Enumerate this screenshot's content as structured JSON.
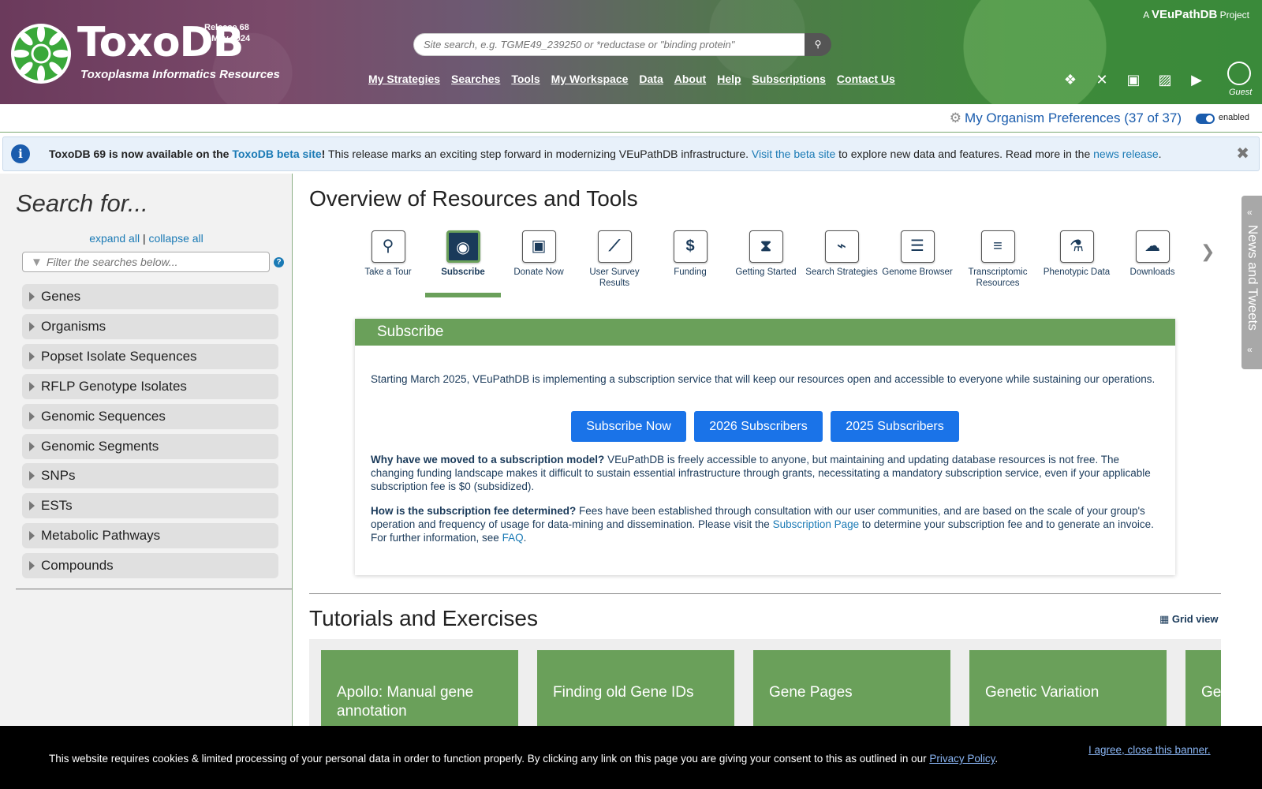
{
  "header": {
    "brand": "ToxoDB",
    "subtitle": "Toxoplasma Informatics Resources",
    "release": "Release 68",
    "release_date": "7 May 2024",
    "vpdb_prefix": "A",
    "vpdb_name": "VEuPathDB",
    "vpdb_suffix": "Project",
    "search_placeholder": "Site search, e.g. TGME49_239250 or *reductase or \"binding protein\"",
    "nav": [
      "My Strategies",
      "Searches",
      "Tools",
      "My Workspace",
      "Data",
      "About",
      "Help",
      "Subscriptions",
      "Contact Us"
    ],
    "guest_label": "Guest"
  },
  "org_pref": {
    "label": "My Organism Preferences (37 of 37)",
    "toggle_label": "enabled"
  },
  "announcement": {
    "bold_prefix": "ToxoDB 69 is now available on the ",
    "beta_link": "ToxoDB beta site",
    "bold_suffix": "!",
    "text1": " This release marks an exciting step forward in modernizing VEuPathDB infrastructure. ",
    "visit_link": "Visit the beta site",
    "text2": " to explore new data and features. Read more in the ",
    "news_link": "news release",
    "text3": "."
  },
  "sidebar": {
    "title": "Search for...",
    "expand_all": "expand all",
    "separator": "|",
    "collapse_all": "collapse all",
    "filter_placeholder": "Filter the searches below...",
    "help": "?",
    "items": [
      "Genes",
      "Organisms",
      "Popset Isolate Sequences",
      "RFLP Genotype Isolates",
      "Genomic Sequences",
      "Genomic Segments",
      "SNPs",
      "ESTs",
      "Metabolic Pathways",
      "Compounds"
    ]
  },
  "main": {
    "title": "Overview of Resources and Tools",
    "tools": [
      {
        "label": "Take a Tour",
        "icon": "motorcycle-icon",
        "glyph": "⚲"
      },
      {
        "label": "Subscribe",
        "icon": "user-circle-icon",
        "glyph": "◉"
      },
      {
        "label": "Donate Now",
        "icon": "gift-icon",
        "glyph": "▣"
      },
      {
        "label": "User Survey Results",
        "icon": "chart-line-icon",
        "glyph": "⟋"
      },
      {
        "label": "Funding",
        "icon": "dollar-icon",
        "glyph": "$"
      },
      {
        "label": "Getting Started",
        "icon": "hourglass-icon",
        "glyph": "⧗"
      },
      {
        "label": "Search Strategies",
        "icon": "strategy-icon",
        "glyph": "⌁"
      },
      {
        "label": "Genome Browser",
        "icon": "sliders-icon",
        "glyph": "☰"
      },
      {
        "label": "Transcriptomic Resources",
        "icon": "list-icon",
        "glyph": "≡"
      },
      {
        "label": "Phenotypic Data",
        "icon": "flask-icon",
        "glyph": "⚗"
      },
      {
        "label": "Downloads",
        "icon": "cloud-download-icon",
        "glyph": "☁"
      }
    ],
    "subscribe": {
      "heading": "Subscribe",
      "intro": "Starting March 2025, VEuPathDB is implementing a subscription service that will keep our resources open and accessible to everyone while sustaining our operations.",
      "buttons": [
        "Subscribe Now",
        "2026 Subscribers",
        "2025 Subscribers"
      ],
      "q1": "Why have we moved to a subscription model?",
      "a1": " VEuPathDB is freely accessible to anyone, but maintaining and updating database resources is not free. The changing funding landscape makes it difficult to sustain essential infrastructure through grants, necessitating a mandatory subscription service, even if your applicable subscription fee is $0 (subsidized).",
      "q2": "How is the subscription fee determined?",
      "a2a": " Fees have been established through consultation with our user communities, and are based on the scale of your group's operation and frequency of usage for data-mining and dissemination. Please visit the ",
      "a2_link": "Subscription Page",
      "a2b": " to determine your subscription fee and to generate an invoice. For further information, see ",
      "faq_link": "FAQ",
      "a2c": "."
    },
    "tutorials_title": "Tutorials and Exercises",
    "grid_view": "Grid view",
    "tutorials": [
      "Apollo: Manual gene annotation",
      "Finding old Gene IDs",
      "Gene Pages",
      "Genetic Variation",
      "Ge"
    ]
  },
  "news_tab": "News and Tweets",
  "cookie": {
    "text": "This website requires cookies & limited processing of your personal data in order to function properly. By clicking any link on this page you are giving your consent to this as outlined in our ",
    "privacy_link": "Privacy Policy",
    "end": ".",
    "agree": "I agree, close this banner."
  },
  "colors": {
    "accent_green": "#6aa05a",
    "link_blue": "#1a7ab5",
    "button_blue": "#1a73e8"
  }
}
